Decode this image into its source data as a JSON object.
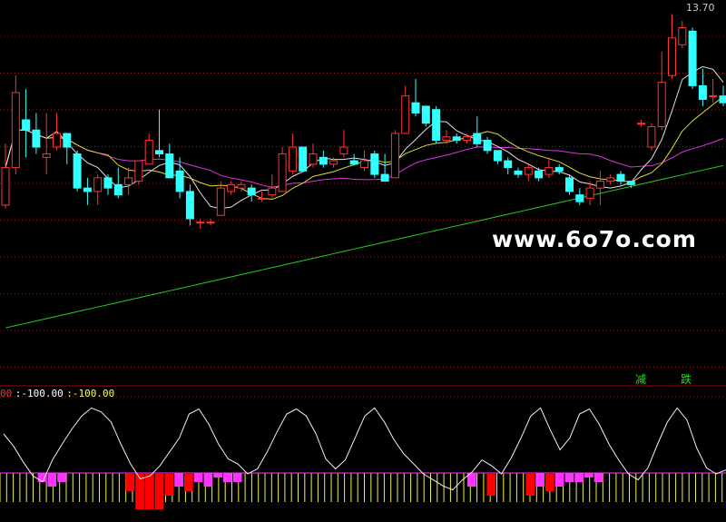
{
  "chart_data": {
    "type": "candlestick",
    "price_label": "13.70",
    "watermark": "www.6o7o.com",
    "signals": [
      "减",
      "跌"
    ],
    "indicator": {
      "header_prefix": "00",
      "header_values": [
        ":-100.00",
        ":-100.00"
      ],
      "line": [
        70,
        58,
        42,
        28,
        22,
        44,
        60,
        75,
        88,
        96,
        92,
        82,
        60,
        40,
        25,
        28,
        38,
        52,
        66,
        90,
        95,
        80,
        60,
        45,
        40,
        30,
        35,
        52,
        72,
        90,
        95,
        88,
        70,
        45,
        35,
        44,
        66,
        88,
        96,
        82,
        64,
        50,
        40,
        30,
        24,
        18,
        14,
        24,
        32,
        44,
        38,
        30,
        46,
        66,
        88,
        96,
        74,
        54,
        66,
        90,
        95,
        80,
        60,
        44,
        30,
        24,
        36,
        60,
        82,
        96,
        84,
        56,
        36,
        30,
        34
      ],
      "bars": [
        0,
        0,
        0,
        0,
        -2,
        -3,
        -2,
        0,
        0,
        0,
        0,
        0,
        0,
        -4,
        -8,
        -8,
        -8,
        -5,
        -3,
        -4,
        -2,
        -3,
        -1,
        -2,
        -2,
        0,
        0,
        0,
        0,
        0,
        0,
        0,
        0,
        0,
        0,
        0,
        0,
        0,
        0,
        0,
        0,
        0,
        0,
        0,
        0,
        0,
        0,
        0,
        -3,
        0,
        -5,
        0,
        0,
        0,
        -5,
        -3,
        -4,
        -3,
        -2,
        -2,
        -1,
        -2,
        0,
        0,
        0,
        0,
        0,
        0,
        0,
        0,
        0,
        0,
        0,
        0,
        0
      ],
      "bar_colors": [
        "#ff33ff",
        "#ff0000"
      ]
    },
    "candles": [
      [
        1.8,
        2.9,
        1.7,
        3.6
      ],
      [
        2.9,
        5.1,
        2.7,
        5.6
      ],
      [
        4.3,
        4.0,
        3.2,
        5.2
      ],
      [
        4.0,
        3.5,
        3.3,
        4.5
      ],
      [
        3.2,
        3.3,
        2.7,
        4.5
      ],
      [
        3.5,
        3.9,
        3.4,
        4.5
      ],
      [
        3.9,
        3.5,
        3.0,
        3.9
      ],
      [
        3.3,
        2.3,
        2.2,
        3.4
      ],
      [
        2.3,
        2.2,
        1.8,
        2.6
      ],
      [
        2.2,
        2.6,
        1.8,
        2.7
      ],
      [
        2.6,
        2.3,
        2.1,
        2.7
      ],
      [
        2.4,
        2.1,
        2.0,
        2.9
      ],
      [
        2.4,
        2.6,
        2.1,
        2.9
      ],
      [
        2.5,
        3.1,
        2.4,
        3.1
      ],
      [
        3.0,
        3.7,
        3.0,
        3.9
      ],
      [
        3.4,
        3.3,
        3.2,
        4.6
      ],
      [
        3.3,
        2.6,
        2.6,
        3.6
      ],
      [
        2.8,
        2.2,
        2.0,
        3.2
      ],
      [
        2.2,
        1.4,
        1.2,
        2.4
      ],
      [
        1.3,
        1.3,
        1.1,
        1.4
      ],
      [
        1.3,
        1.3,
        1.2,
        1.4
      ],
      [
        1.5,
        2.3,
        1.5,
        2.5
      ],
      [
        2.2,
        2.4,
        2.1,
        2.5
      ],
      [
        2.3,
        2.4,
        2.2,
        2.5
      ],
      [
        2.3,
        2.1,
        1.9,
        2.4
      ],
      [
        2.0,
        2.0,
        1.9,
        2.2
      ],
      [
        2.1,
        2.3,
        2.0,
        2.7
      ],
      [
        2.2,
        3.3,
        2.2,
        3.5
      ],
      [
        2.8,
        3.5,
        2.7,
        3.9
      ],
      [
        3.5,
        2.8,
        2.8,
        3.5
      ],
      [
        3.0,
        3.3,
        2.9,
        3.6
      ],
      [
        3.2,
        3.0,
        2.9,
        3.4
      ],
      [
        3.0,
        3.1,
        2.9,
        3.2
      ],
      [
        3.3,
        3.5,
        3.2,
        4.0
      ],
      [
        3.1,
        3.0,
        3.0,
        3.3
      ],
      [
        2.9,
        3.1,
        2.8,
        3.4
      ],
      [
        3.3,
        2.7,
        2.6,
        3.4
      ],
      [
        2.7,
        2.5,
        2.5,
        3.3
      ],
      [
        2.6,
        3.9,
        2.6,
        4.0
      ],
      [
        3.9,
        5.0,
        3.9,
        5.3
      ],
      [
        4.8,
        4.5,
        4.4,
        5.5
      ],
      [
        4.7,
        4.2,
        4.1,
        4.7
      ],
      [
        4.6,
        3.7,
        3.6,
        4.7
      ],
      [
        3.7,
        3.8,
        3.6,
        4.0
      ],
      [
        3.8,
        3.7,
        3.6,
        3.9
      ],
      [
        3.7,
        3.8,
        3.6,
        3.9
      ],
      [
        3.9,
        3.6,
        3.5,
        4.4
      ],
      [
        3.7,
        3.4,
        3.3,
        3.8
      ],
      [
        3.4,
        3.1,
        3.0,
        3.4
      ],
      [
        3.1,
        2.9,
        2.7,
        3.2
      ],
      [
        2.8,
        2.7,
        2.6,
        2.9
      ],
      [
        2.7,
        2.9,
        2.5,
        3.0
      ],
      [
        2.8,
        2.6,
        2.5,
        2.9
      ],
      [
        2.7,
        2.9,
        2.6,
        3.2
      ],
      [
        2.9,
        2.8,
        2.7,
        3.0
      ],
      [
        2.6,
        2.2,
        2.1,
        2.7
      ],
      [
        2.1,
        1.9,
        1.8,
        2.3
      ],
      [
        2.0,
        2.3,
        1.8,
        2.5
      ],
      [
        2.3,
        2.5,
        1.8,
        2.8
      ],
      [
        2.5,
        2.6,
        2.4,
        2.7
      ],
      [
        2.7,
        2.5,
        2.4,
        2.8
      ],
      [
        2.5,
        2.4,
        2.3,
        2.5
      ],
      [
        4.2,
        4.2,
        4.1,
        4.3
      ],
      [
        3.5,
        4.1,
        3.4,
        4.2
      ],
      [
        4.1,
        5.4,
        4.0,
        6.3
      ],
      [
        5.6,
        6.7,
        5.5,
        7.4
      ],
      [
        6.5,
        7.0,
        6.4,
        7.2
      ],
      [
        6.9,
        5.3,
        5.2,
        7.0
      ],
      [
        5.3,
        4.9,
        4.7,
        5.8
      ],
      [
        5.0,
        5.0,
        4.8,
        5.5
      ],
      [
        5.0,
        4.8,
        4.7,
        5.3
      ]
    ]
  }
}
